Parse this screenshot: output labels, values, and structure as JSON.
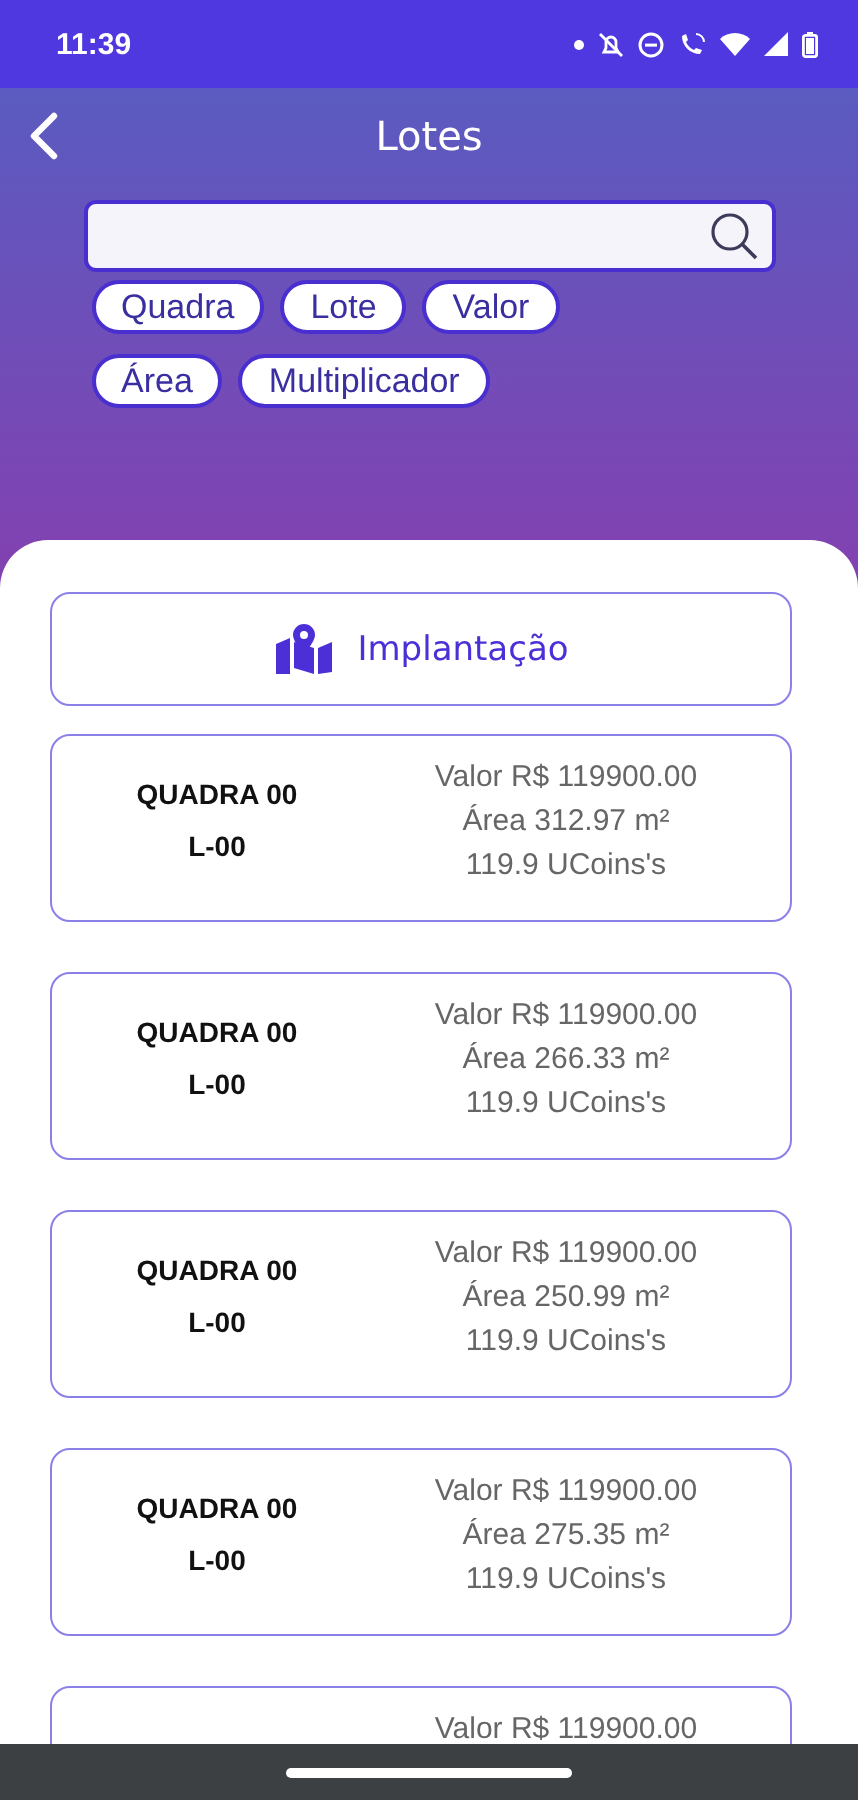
{
  "status_bar": {
    "time": "11:39"
  },
  "header": {
    "title": "Lotes"
  },
  "filters": [
    {
      "label": "Quadra"
    },
    {
      "label": "Lote"
    },
    {
      "label": "Valor"
    },
    {
      "label": "Área"
    },
    {
      "label": "Multiplicador"
    }
  ],
  "implantacao_button": {
    "label": "Implantação"
  },
  "lots": [
    {
      "quadra": "QUADRA 00",
      "lote": "L-00",
      "valor": "Valor R$ 119900.00",
      "area": "Área 312.97 m²",
      "ucoins": "119.9 UCoins's"
    },
    {
      "quadra": "QUADRA 00",
      "lote": "L-00",
      "valor": "Valor R$ 119900.00",
      "area": "Área 266.33 m²",
      "ucoins": "119.9 UCoins's"
    },
    {
      "quadra": "QUADRA 00",
      "lote": "L-00",
      "valor": "Valor R$ 119900.00",
      "area": "Área 250.99 m²",
      "ucoins": "119.9 UCoins's"
    },
    {
      "quadra": "QUADRA 00",
      "lote": "L-00",
      "valor": "Valor R$ 119900.00",
      "area": "Área 275.35 m²",
      "ucoins": "119.9 UCoins's"
    },
    {
      "valor": "Valor R$ 119900.00"
    }
  ]
}
